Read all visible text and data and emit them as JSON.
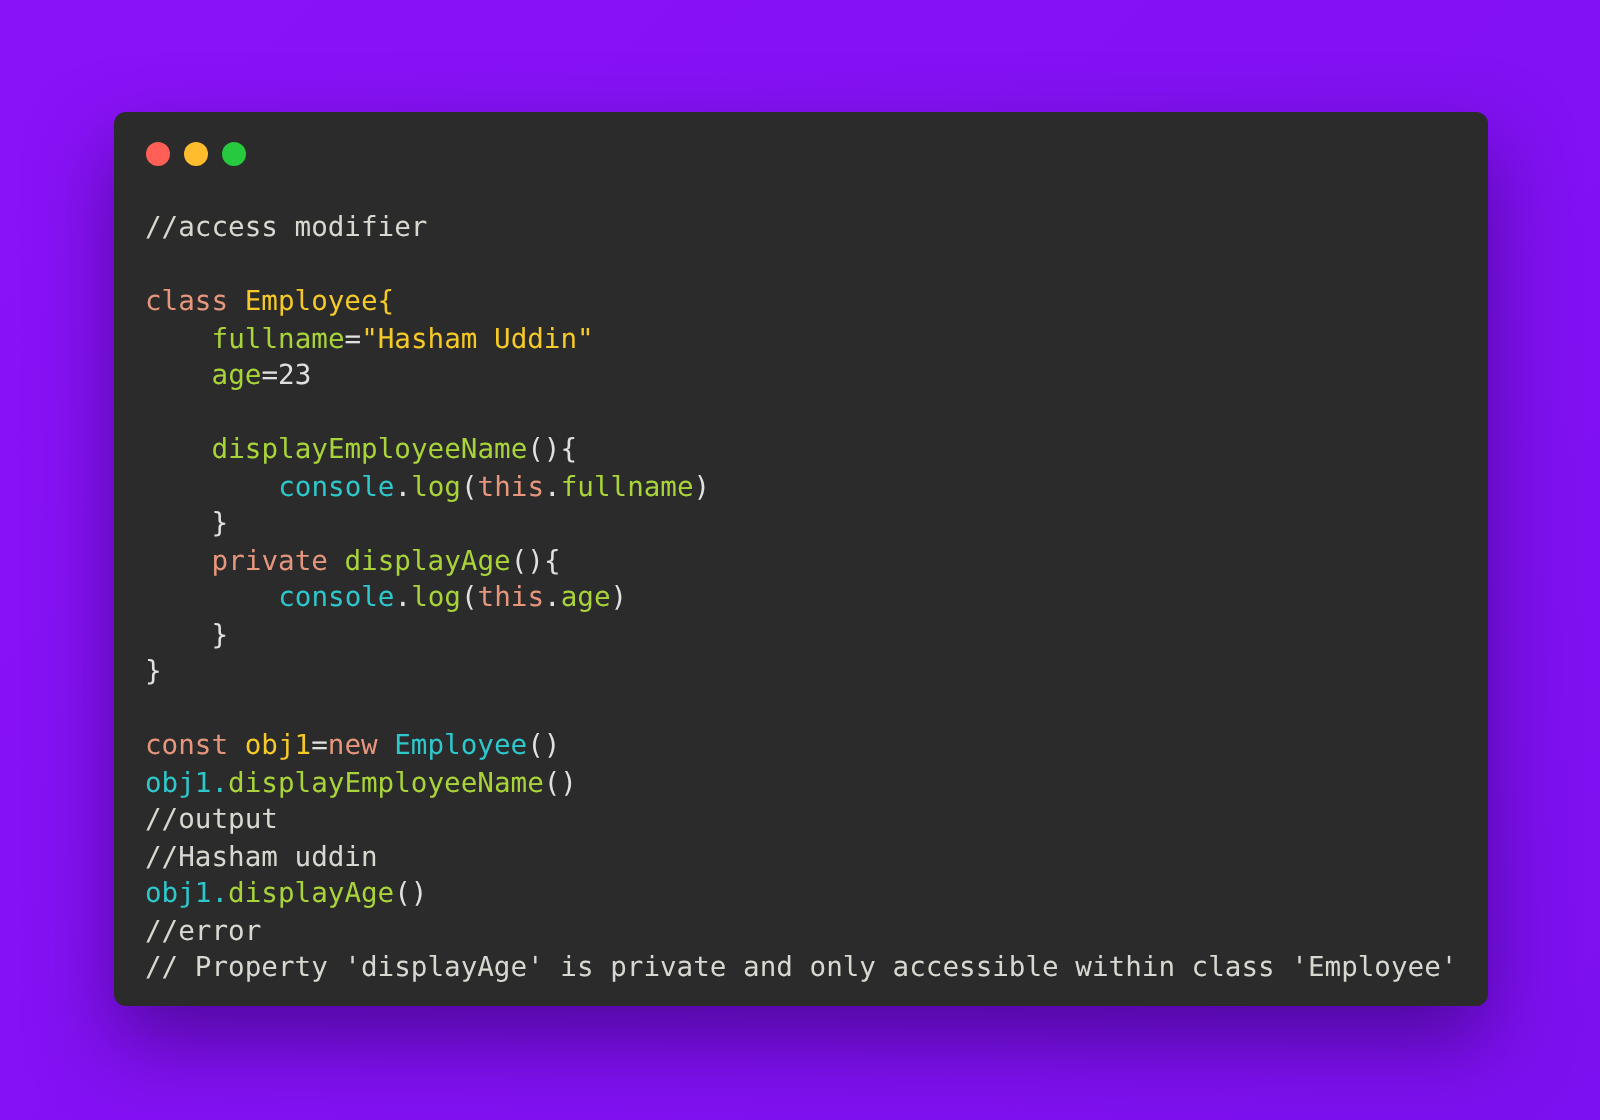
{
  "window": {
    "controls": [
      {
        "color": "#ff5f56"
      },
      {
        "color": "#ffbd2e"
      },
      {
        "color": "#27c93f"
      }
    ]
  },
  "code": [
    {
      "kind": "code",
      "tokens": [
        {
          "text": "//access modifier",
          "kind": "comment"
        }
      ]
    },
    {
      "kind": "blank"
    },
    {
      "kind": "code",
      "tokens": [
        {
          "text": "class ",
          "kind": "keyword"
        },
        {
          "text": "Employee",
          "kind": "type"
        },
        {
          "text": "{",
          "kind": "type"
        }
      ],
      "children": [
        {
          "kind": "code",
          "tokens": [
            {
              "text": "fullname",
              "kind": "property"
            },
            {
              "text": "=",
              "kind": "punct"
            },
            {
              "text": "\"Hasham Uddin\"",
              "kind": "string"
            }
          ]
        },
        {
          "kind": "code",
          "tokens": [
            {
              "text": "age",
              "kind": "property"
            },
            {
              "text": "=23",
              "kind": "punct"
            }
          ]
        },
        {
          "kind": "blank"
        },
        {
          "kind": "code",
          "tokens": [
            {
              "text": "displayEmployeeName",
              "kind": "property"
            },
            {
              "text": "(){",
              "kind": "punct"
            }
          ],
          "children": [
            {
              "kind": "code",
              "tokens": [
                {
                  "text": "console",
                  "kind": "builtin"
                },
                {
                  "text": ".",
                  "kind": "punct"
                },
                {
                  "text": "log",
                  "kind": "property"
                },
                {
                  "text": "(",
                  "kind": "punct"
                },
                {
                  "text": "this",
                  "kind": "keyword"
                },
                {
                  "text": ".",
                  "kind": "punct"
                },
                {
                  "text": "fullname",
                  "kind": "property"
                },
                {
                  "text": ")",
                  "kind": "punct"
                }
              ]
            }
          ]
        },
        {
          "kind": "code",
          "tokens": [
            {
              "text": "}",
              "kind": "punct"
            }
          ]
        },
        {
          "kind": "code",
          "tokens": [
            {
              "text": "private ",
              "kind": "keyword"
            },
            {
              "text": "displayAge",
              "kind": "property"
            },
            {
              "text": "(){",
              "kind": "punct"
            }
          ],
          "children": [
            {
              "kind": "code",
              "tokens": [
                {
                  "text": "console",
                  "kind": "builtin"
                },
                {
                  "text": ".",
                  "kind": "punct"
                },
                {
                  "text": "log",
                  "kind": "property"
                },
                {
                  "text": "(",
                  "kind": "punct"
                },
                {
                  "text": "this",
                  "kind": "keyword"
                },
                {
                  "text": ".",
                  "kind": "punct"
                },
                {
                  "text": "age",
                  "kind": "property"
                },
                {
                  "text": ")",
                  "kind": "punct"
                }
              ]
            }
          ]
        },
        {
          "kind": "code",
          "tokens": [
            {
              "text": "}",
              "kind": "punct"
            }
          ]
        }
      ]
    },
    {
      "kind": "code",
      "tokens": [
        {
          "text": "}",
          "kind": "punct"
        }
      ]
    },
    {
      "kind": "blank"
    },
    {
      "kind": "code",
      "tokens": [
        {
          "text": "const ",
          "kind": "keyword"
        },
        {
          "text": "obj1",
          "kind": "type"
        },
        {
          "text": "=",
          "kind": "punct"
        },
        {
          "text": "new ",
          "kind": "keyword"
        },
        {
          "text": "Employee",
          "kind": "builtin"
        },
        {
          "text": "()",
          "kind": "punct"
        }
      ]
    },
    {
      "kind": "code",
      "tokens": [
        {
          "text": "obj1.",
          "kind": "builtin"
        },
        {
          "text": "displayEmployeeName",
          "kind": "property"
        },
        {
          "text": "()",
          "kind": "punct"
        }
      ]
    },
    {
      "kind": "code",
      "tokens": [
        {
          "text": "//output",
          "kind": "comment"
        }
      ]
    },
    {
      "kind": "code",
      "tokens": [
        {
          "text": "//Hasham uddin",
          "kind": "comment"
        }
      ]
    },
    {
      "kind": "code",
      "tokens": [
        {
          "text": "obj1.",
          "kind": "builtin"
        },
        {
          "text": "displayAge",
          "kind": "property"
        },
        {
          "text": "()",
          "kind": "punct"
        }
      ]
    },
    {
      "kind": "code",
      "tokens": [
        {
          "text": "//error",
          "kind": "comment"
        }
      ]
    },
    {
      "kind": "code",
      "tokens": [
        {
          "text": "// Property 'displayAge' is private and only accessible within class 'Employee'",
          "kind": "comment"
        }
      ]
    }
  ]
}
